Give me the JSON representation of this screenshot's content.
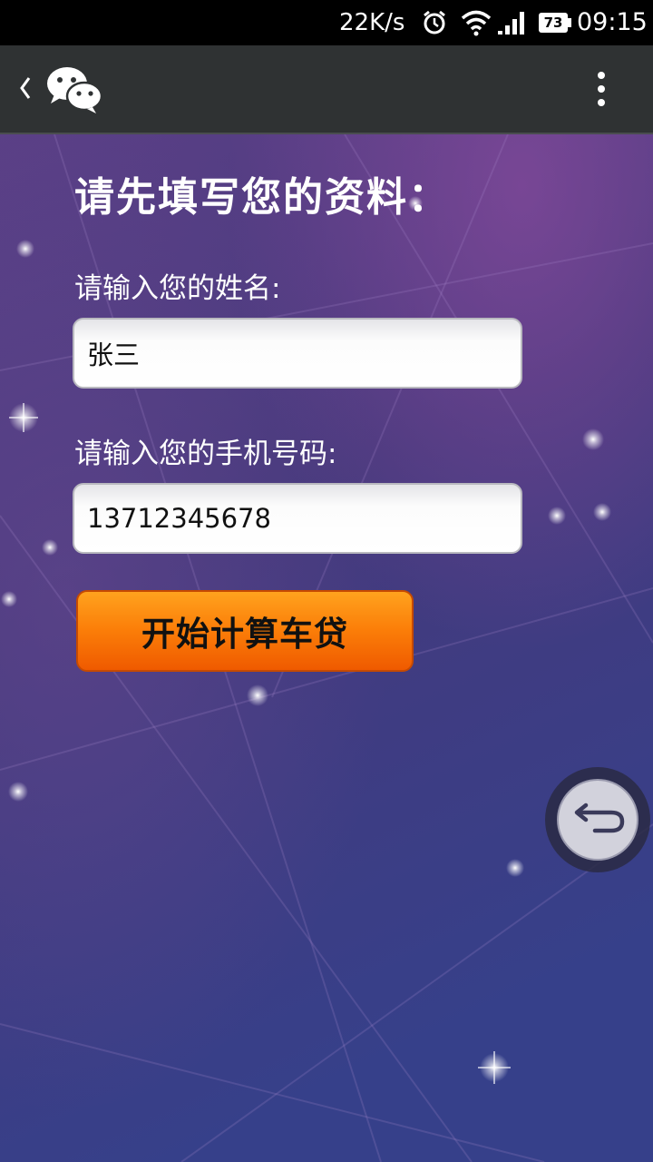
{
  "status_bar": {
    "network_speed": "22K/s",
    "battery_level": "73",
    "time": "09:15",
    "icons": [
      "alarm-icon",
      "wifi-icon",
      "signal-icon",
      "battery-icon"
    ]
  },
  "title_bar": {
    "back_icon": "chevron-left-icon",
    "logo_icon": "wechat-logo-icon",
    "menu_icon": "more-vertical-icon"
  },
  "form": {
    "heading": "请先填写您的资料：",
    "name_label": "请输入您的姓名:",
    "name_value": "张三",
    "phone_label": "请输入您的手机号码:",
    "phone_value": "13712345678",
    "submit_label": "开始计算车贷"
  },
  "floating_back_icon": "return-arrow-icon",
  "colors": {
    "status_bar_bg": "#000000",
    "title_bar_bg": "#2f3233",
    "background": "#3d3a78",
    "button_orange": "#fb7d08"
  }
}
